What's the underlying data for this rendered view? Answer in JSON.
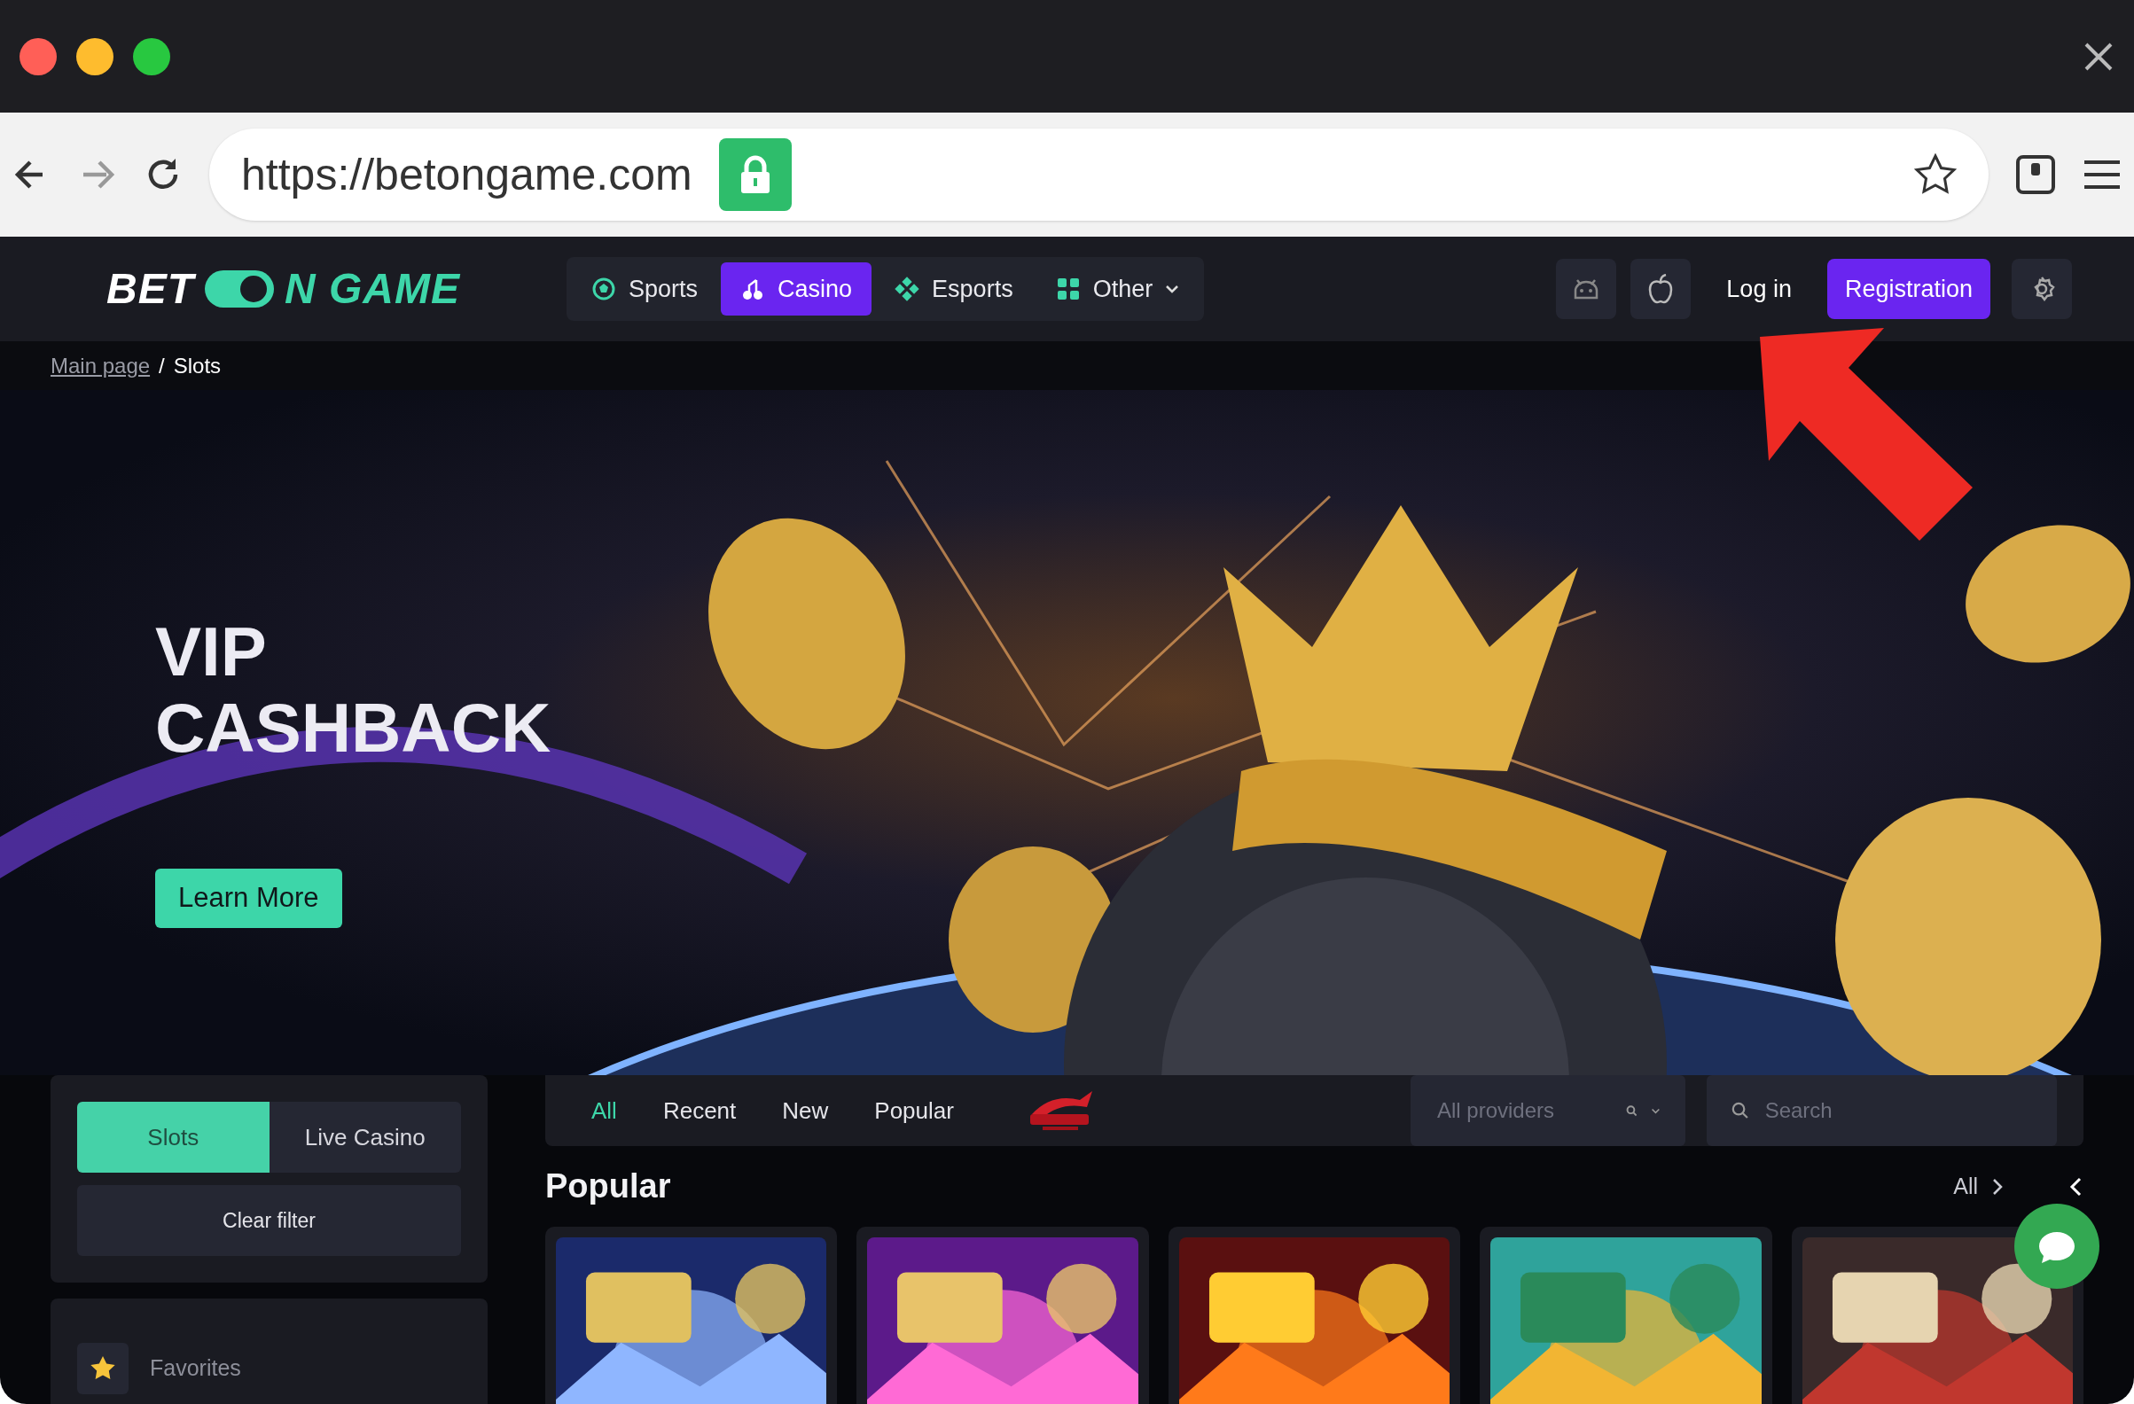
{
  "window": {
    "lights": [
      {
        "color": "#ff5f57"
      },
      {
        "color": "#febc2e"
      },
      {
        "color": "#28c840"
      }
    ]
  },
  "browser": {
    "url": "https://betongame.com",
    "secure": true
  },
  "site_nav": {
    "logo": {
      "left": "BET",
      "right": "N GAME"
    },
    "tabs": [
      {
        "label": "Sports",
        "selected": false,
        "dropdown": false
      },
      {
        "label": "Casino",
        "selected": true,
        "dropdown": false
      },
      {
        "label": "Esports",
        "selected": false,
        "dropdown": false
      },
      {
        "label": "Other",
        "selected": false,
        "dropdown": true
      }
    ],
    "login": "Log in",
    "register": "Registration"
  },
  "breadcrumb": {
    "separator": "/",
    "items": [
      {
        "label": "Main page",
        "link": true
      },
      {
        "label": "Slots",
        "link": false
      }
    ]
  },
  "hero": {
    "title_lines": [
      "VIP",
      "CASHBACK"
    ],
    "button": "Learn More"
  },
  "sidebar": {
    "tabs": [
      {
        "label": "Slots",
        "selected": true
      },
      {
        "label": "Live Casino",
        "selected": false
      }
    ],
    "clear_button": "Clear filter",
    "items": [
      {
        "label": "Favorites"
      }
    ]
  },
  "filters": {
    "tabs": [
      {
        "label": "All",
        "selected": true
      },
      {
        "label": "Recent",
        "selected": false
      },
      {
        "label": "New",
        "selected": false
      },
      {
        "label": "Popular",
        "selected": false
      }
    ],
    "providers": {
      "placeholder": "All providers"
    },
    "search": {
      "placeholder": "Search"
    }
  },
  "section": {
    "title": "Popular",
    "all_link": "All"
  }
}
